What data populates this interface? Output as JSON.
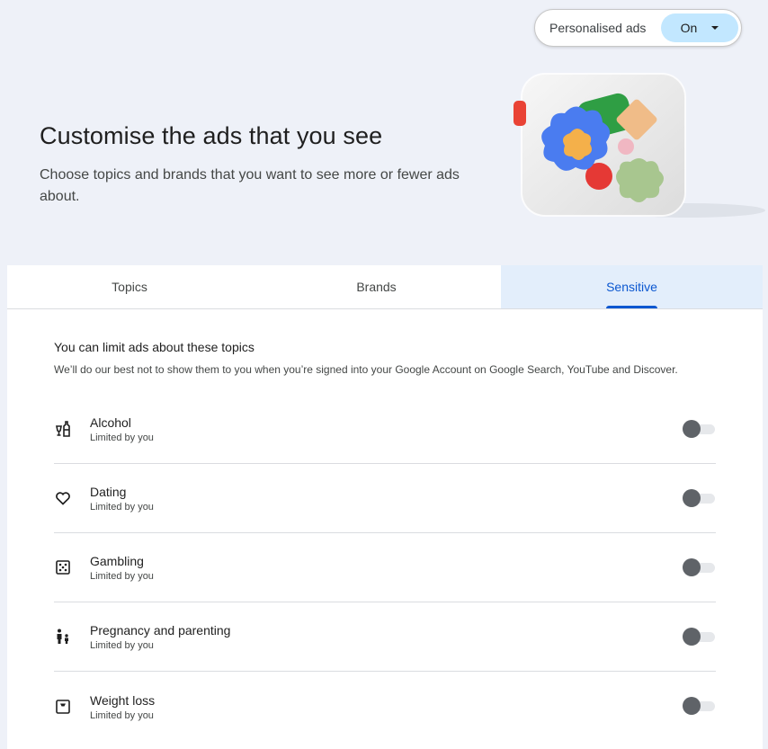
{
  "header": {
    "personalised_ads_label": "Personalised ads",
    "personalised_ads_value": "On",
    "title": "Customise the ads that you see",
    "subtitle": "Choose topics and brands that you want to see more or fewer ads about."
  },
  "tabs": [
    {
      "label": "Topics",
      "selected": false
    },
    {
      "label": "Brands",
      "selected": false
    },
    {
      "label": "Sensitive",
      "selected": true
    }
  ],
  "sensitive": {
    "title": "You can limit ads about these topics",
    "description": "We’ll do our best not to show them to you when you’re signed into your Google Account on Google Search, YouTube and Discover.",
    "items": [
      {
        "label": "Alcohol",
        "status": "Limited by you",
        "icon": "alcohol-icon",
        "enabled": false
      },
      {
        "label": "Dating",
        "status": "Limited by you",
        "icon": "heart-icon",
        "enabled": false
      },
      {
        "label": "Gambling",
        "status": "Limited by you",
        "icon": "dice-icon",
        "enabled": false
      },
      {
        "label": "Pregnancy and parenting",
        "status": "Limited by you",
        "icon": "parent-child-icon",
        "enabled": false
      },
      {
        "label": "Weight loss",
        "status": "Limited by you",
        "icon": "scale-icon",
        "enabled": false
      }
    ]
  },
  "colors": {
    "accent": "#0b57d0",
    "pill_select": "#c2e7ff",
    "background": "#eef1f8",
    "selected_tab": "#e3eefb",
    "toggle_knob": "#5f6368"
  }
}
